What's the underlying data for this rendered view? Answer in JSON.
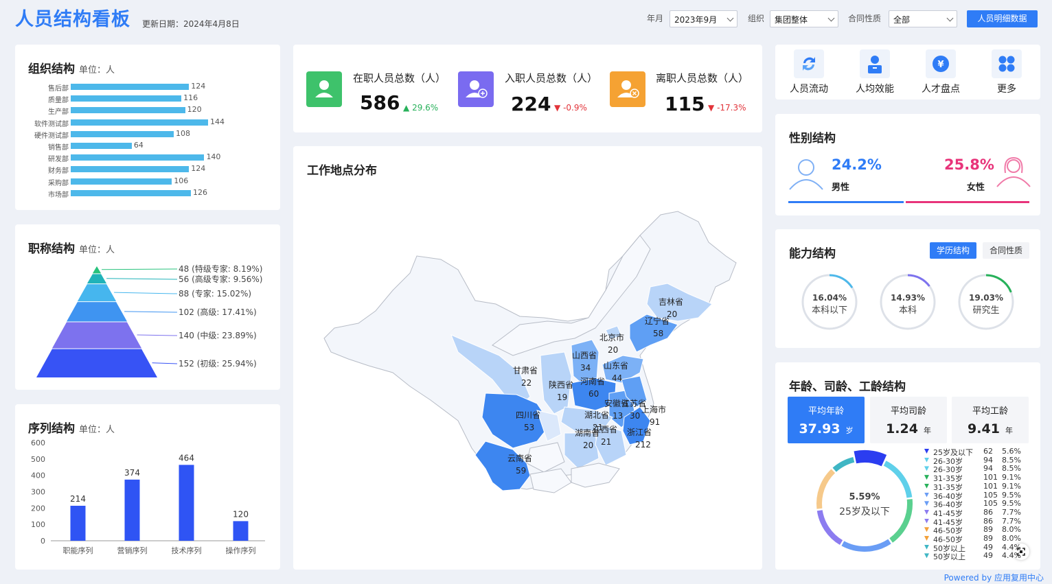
{
  "header": {
    "title": "人员结构看板",
    "update_date": "更新日期：2024年4月8日",
    "filters": [
      {
        "label": "年月",
        "value": "2023年9月"
      },
      {
        "label": "组织",
        "value": "集团整体"
      },
      {
        "label": "合同性质",
        "value": "全部"
      }
    ],
    "detail_button": "人员明细数据"
  },
  "org": {
    "title": "组织结构",
    "unit": "单位：人",
    "chart_data": {
      "type": "bar",
      "categories": [
        "售后部",
        "质量部",
        "生产部",
        "软件测试部",
        "硬件测试部",
        "销售部",
        "研发部",
        "财务部",
        "采购部",
        "市场部"
      ],
      "values": [
        124,
        116,
        120,
        144,
        108,
        64,
        140,
        124,
        106,
        126
      ]
    }
  },
  "title_level": {
    "title": "职称结构",
    "unit": "单位：人",
    "chart_data": {
      "type": "pyramid",
      "categories": [
        "特级专家",
        "高级专家",
        "专家",
        "高级",
        "中级",
        "初级"
      ],
      "values": [
        48,
        56,
        88,
        102,
        140,
        152
      ],
      "labels": [
        "48 (特级专家: 8.19%)",
        "56 (高级专家: 9.56%)",
        "88 (专家: 15.02%)",
        "102 (高级: 17.41%)",
        "140 (中级: 23.89%)",
        "152 (初级: 25.94%)"
      ],
      "colors": [
        "#27c27c",
        "#20b3b9",
        "#46b6ee",
        "#3f94f1",
        "#7d72ee",
        "#3753f5"
      ]
    }
  },
  "sequence": {
    "title": "序列结构",
    "unit": "单位：人",
    "chart_data": {
      "type": "bar",
      "categories": [
        "职能序列",
        "营销序列",
        "技术序列",
        "操作序列"
      ],
      "values": [
        214,
        374,
        464,
        120
      ],
      "ylim": [
        0,
        600
      ],
      "yticks": [
        "600",
        "500",
        "400",
        "300",
        "200",
        "100",
        "0"
      ]
    }
  },
  "kpis": [
    {
      "label": "在职人员总数（人）",
      "value": "586",
      "delta": "29.6%",
      "dir": "up",
      "color": "#3ec26b"
    },
    {
      "label": "入职人员总数（人）",
      "value": "224",
      "delta": "-0.9%",
      "dir": "down",
      "color": "#7a6bf0"
    },
    {
      "label": "离职人员总数（人）",
      "value": "115",
      "delta": "-17.3%",
      "dir": "down",
      "color": "#f5a233"
    }
  ],
  "map": {
    "title": "工作地点分布",
    "provinces": [
      {
        "name": "吉林省",
        "value": "20"
      },
      {
        "name": "辽宁省",
        "value": "58"
      },
      {
        "name": "北京市",
        "value": "20"
      },
      {
        "name": "山西省",
        "value": "34"
      },
      {
        "name": "山东省",
        "value": "44"
      },
      {
        "name": "甘肃省",
        "value": "22"
      },
      {
        "name": "陕西省",
        "value": "19"
      },
      {
        "name": "河南省",
        "value": "60"
      },
      {
        "name": "安徽省",
        "value": "13"
      },
      {
        "name": "江苏省",
        "value": "30"
      },
      {
        "name": "上海市",
        "value": "91"
      },
      {
        "name": "四川省",
        "value": "53"
      },
      {
        "name": "湖北省",
        "value": "21"
      },
      {
        "name": "浙江省",
        "value": "212"
      },
      {
        "name": "湖南省",
        "value": "20"
      },
      {
        "name": "江西省",
        "value": "21"
      },
      {
        "name": "云南省",
        "value": "59"
      }
    ]
  },
  "quick_links": [
    {
      "label": "人员流动",
      "icon": "refresh-icon"
    },
    {
      "label": "人均效能",
      "icon": "user-badge-icon"
    },
    {
      "label": "人才盘点",
      "icon": "yen-icon"
    },
    {
      "label": "更多",
      "icon": "grid-icon"
    }
  ],
  "gender": {
    "title": "性别结构",
    "male_pct": "24.2%",
    "male_label": "男性",
    "female_pct": "25.8%",
    "female_label": "女性",
    "male_color": "#2f7cf6",
    "female_color": "#e8337a"
  },
  "ability": {
    "title": "能力结构",
    "tabs": [
      "学历结构",
      "合同性质"
    ],
    "rings": [
      {
        "pct": "16.04%",
        "label": "本科以下",
        "value": 16.04,
        "color": "#4db8ea"
      },
      {
        "pct": "14.93%",
        "label": "本科",
        "value": 14.93,
        "color": "#7d72ee"
      },
      {
        "pct": "19.03%",
        "label": "研究生",
        "value": 19.03,
        "color": "#27b15a"
      }
    ]
  },
  "age": {
    "title": "年龄、司龄、工龄结构",
    "tiles": [
      {
        "label": "平均年龄",
        "value": "37.93",
        "unit": "岁"
      },
      {
        "label": "平均司龄",
        "value": "1.24",
        "unit": "年"
      },
      {
        "label": "平均工龄",
        "value": "9.41",
        "unit": "年"
      }
    ],
    "donut_pct": "5.59%",
    "donut_label": "25岁及以下",
    "chart_data": {
      "type": "pie",
      "categories": [
        "25岁及以下",
        "26-30岁",
        "31-35岁",
        "36-40岁",
        "41-45岁",
        "46-50岁",
        "50岁以上"
      ],
      "values": [
        62,
        94,
        101,
        105,
        86,
        89,
        49
      ],
      "colors": [
        "#2b3df0",
        "#5fd0ea",
        "#5ad08f",
        "#6a9df5",
        "#8c7cf0",
        "#f6c98a",
        "#3fb6c4"
      ]
    },
    "legend": [
      {
        "name": "25岁及以下",
        "count": "62",
        "pct": "5.6%",
        "color": "#2b3df0"
      },
      {
        "name": "26-30岁",
        "count": "94",
        "pct": "8.5%",
        "color": "#5fd0ea"
      },
      {
        "name": "26-30岁",
        "count": "94",
        "pct": "8.5%",
        "color": "#5fd0ea"
      },
      {
        "name": "31-35岁",
        "count": "101",
        "pct": "9.1%",
        "color": "#27b15a"
      },
      {
        "name": "31-35岁",
        "count": "101",
        "pct": "9.1%",
        "color": "#27b15a"
      },
      {
        "name": "36-40岁",
        "count": "105",
        "pct": "9.5%",
        "color": "#6a9df5"
      },
      {
        "name": "36-40岁",
        "count": "105",
        "pct": "9.5%",
        "color": "#6a9df5"
      },
      {
        "name": "41-45岁",
        "count": "86",
        "pct": "7.7%",
        "color": "#8c7cf0"
      },
      {
        "name": "41-45岁",
        "count": "86",
        "pct": "7.7%",
        "color": "#8c7cf0"
      },
      {
        "name": "46-50岁",
        "count": "89",
        "pct": "8.0%",
        "color": "#f3a13a"
      },
      {
        "name": "46-50岁",
        "count": "89",
        "pct": "8.0%",
        "color": "#f3a13a"
      },
      {
        "name": "50岁以上",
        "count": "49",
        "pct": "4.4%",
        "color": "#3fb6c4"
      },
      {
        "name": "50岁以上",
        "count": "49",
        "pct": "4.4%",
        "color": "#3fb6c4"
      }
    ]
  },
  "powered": "Powered by 应用复用中心"
}
